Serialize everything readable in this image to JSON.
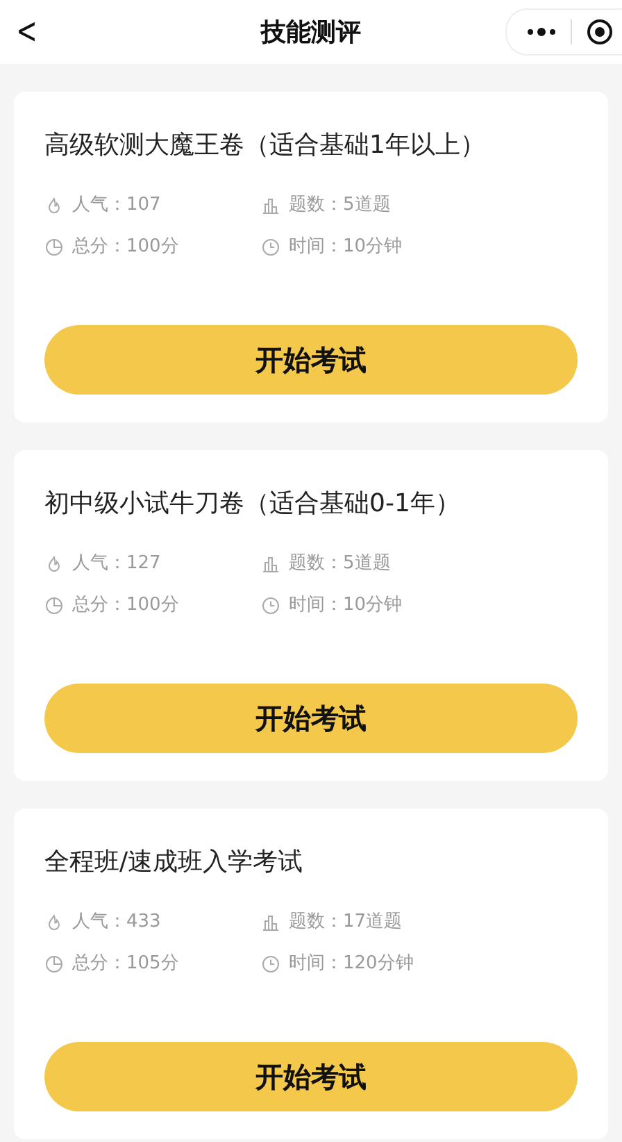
{
  "nav": {
    "back": "<",
    "title": "技能测评"
  },
  "exams": [
    {
      "title": "高级软测大魔王卷（适合基础1年以上）",
      "stats": [
        {
          "kind": "popularity",
          "text": "人气：107"
        },
        {
          "kind": "questions",
          "text": "题数：5道题"
        },
        {
          "kind": "score",
          "text": "总分：100分"
        },
        {
          "kind": "time",
          "text": "时间：10分钟"
        }
      ],
      "button": "开始考试"
    },
    {
      "title": "初中级小试牛刀卷（适合基础0-1年）",
      "stats": [
        {
          "kind": "popularity",
          "text": "人气：127"
        },
        {
          "kind": "questions",
          "text": "题数：5道题"
        },
        {
          "kind": "score",
          "text": "总分：100分"
        },
        {
          "kind": "time",
          "text": "时间：10分钟"
        }
      ],
      "button": "开始考试"
    },
    {
      "title": "全程班/速成班入学考试",
      "stats": [
        {
          "kind": "popularity",
          "text": "人气：433"
        },
        {
          "kind": "questions",
          "text": "题数：17道题"
        },
        {
          "kind": "score",
          "text": "总分：105分"
        },
        {
          "kind": "time",
          "text": "时间：120分钟"
        }
      ],
      "button": "开始考试"
    }
  ]
}
